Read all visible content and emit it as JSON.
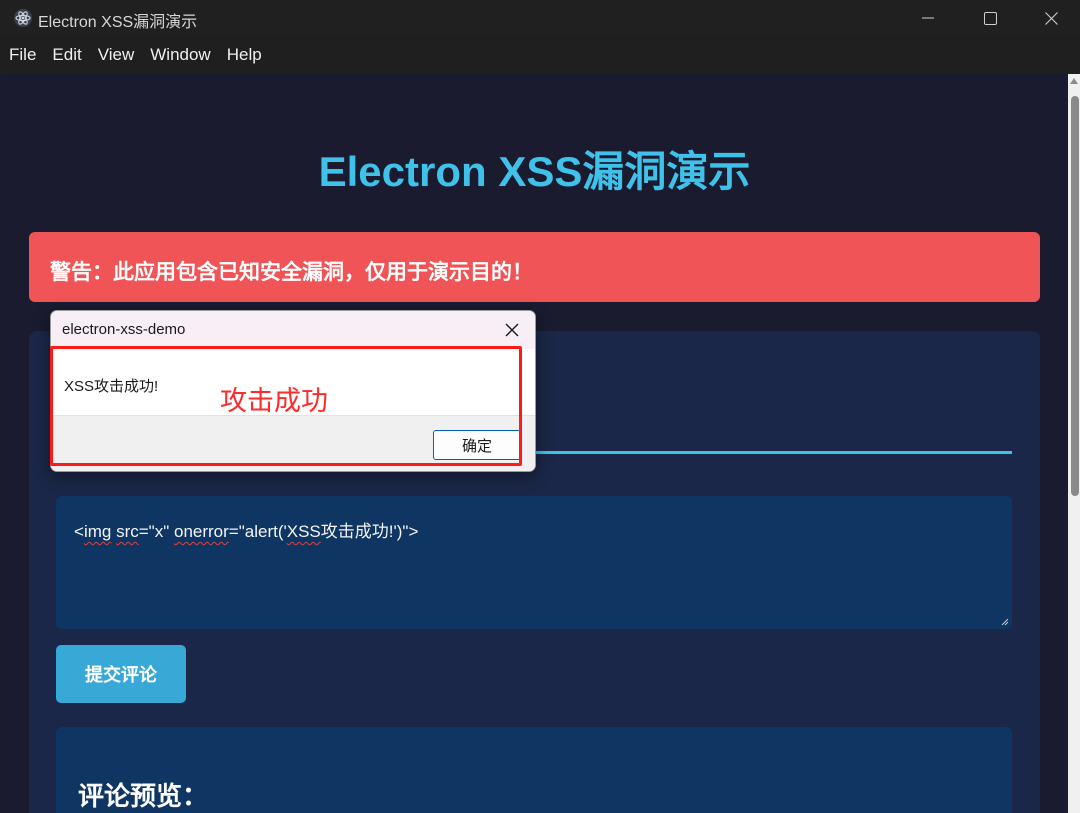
{
  "window": {
    "title": "Electron XSS漏洞演示",
    "icon": "electron-atom-icon",
    "controls": [
      "minimize-icon",
      "maximize-icon",
      "close-icon"
    ]
  },
  "menu": {
    "items": [
      {
        "label": "File"
      },
      {
        "label": "Edit"
      },
      {
        "label": "View"
      },
      {
        "label": "Window"
      },
      {
        "label": "Help"
      }
    ]
  },
  "page": {
    "title": "Electron XSS漏洞演示",
    "warning": "警告：此应用包含已知安全漏洞，仅用于演示目的！",
    "comment_input": {
      "parts": [
        "<",
        "img",
        " ",
        "src",
        "=\"x\" ",
        "onerror",
        "=\"alert('",
        "XSS",
        "攻击成功!')\">"
      ]
    },
    "submit_label": "提交评论",
    "preview_title": "评论预览："
  },
  "dialog": {
    "title": "electron-xss-demo",
    "message": "XSS攻击成功!",
    "ok_label": "确定"
  },
  "annotation": {
    "text": "攻击成功",
    "color": "#ff2a2a"
  },
  "colors": {
    "accent": "#3fc1ea",
    "warning": "#f05457",
    "button": "#38a8d6",
    "input_bg": "#0f3563",
    "page_bg": "#1a1b2f"
  }
}
